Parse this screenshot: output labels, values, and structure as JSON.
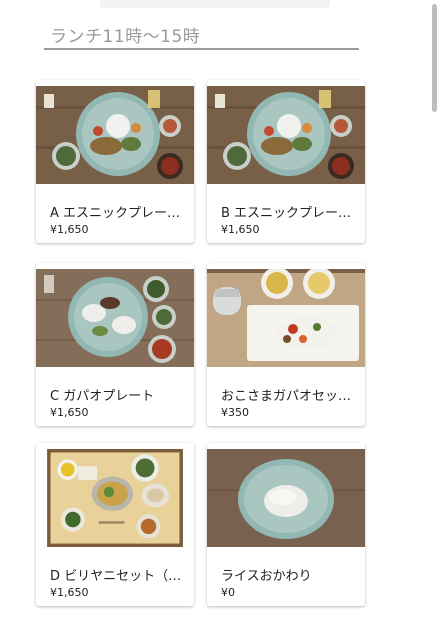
{
  "section": {
    "title": "ランチ11時〜15時"
  },
  "menu_items": [
    {
      "name": "A エスニックプレー…",
      "price": "¥1,650",
      "photo": "ethnic-plate-photo"
    },
    {
      "name": "B エスニックプレー…",
      "price": "¥1,650",
      "photo": "ethnic-plate-photo"
    },
    {
      "name": "C ガパオプレート",
      "price": "¥1,650",
      "photo": "gapao-plate-photo"
    },
    {
      "name": "おこさまガパオセッ…",
      "price": "¥350",
      "photo": "kids-gapao-photo"
    },
    {
      "name": "D ビリヤニセット（…",
      "price": "¥1,650",
      "photo": "biryani-set-photo"
    },
    {
      "name": "ライスおかわり",
      "price": "¥0",
      "photo": "rice-refill-photo"
    }
  ],
  "colors": {
    "header_text": "#9a9a9a",
    "text": "#222222",
    "wood": "#7a6048",
    "plate": "#8fb1ac"
  }
}
